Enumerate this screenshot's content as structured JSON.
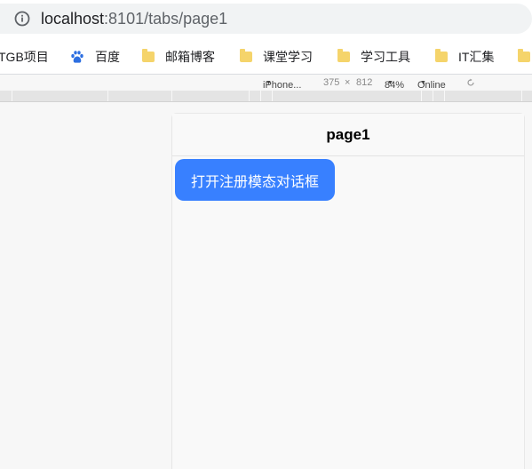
{
  "browser": {
    "url_host": "localhost",
    "url_path": ":8101/tabs/page1"
  },
  "bookmarks": [
    {
      "label": "TGB项目",
      "icon": "none"
    },
    {
      "label": "百度",
      "icon": "baidu-paw-icon"
    },
    {
      "label": "邮箱博客",
      "icon": "folder-icon"
    },
    {
      "label": "课堂学习",
      "icon": "folder-icon"
    },
    {
      "label": "学习工具",
      "icon": "folder-icon"
    },
    {
      "label": "IT汇集",
      "icon": "folder-icon"
    }
  ],
  "device_toolbar": {
    "device": "iPhone...",
    "width": "375",
    "times": "×",
    "height": "812",
    "zoom": "84%",
    "network": "Online"
  },
  "page": {
    "title": "page1",
    "button_label": "打开注册模态对话框"
  },
  "colors": {
    "primary": "#3880ff",
    "folder": "#f5d46b",
    "baidu_blue": "#2d6fe1"
  }
}
